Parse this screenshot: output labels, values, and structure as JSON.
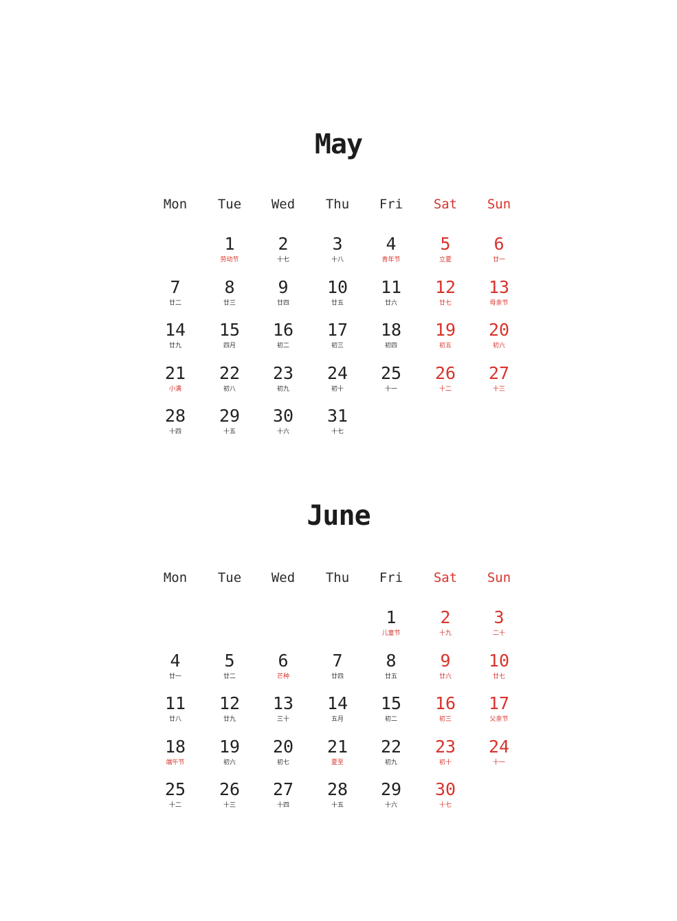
{
  "colors": {
    "text": "#222222",
    "weekend": "#d8332b",
    "background": "#ffffff"
  },
  "weekdays": [
    "Mon",
    "Tue",
    "Wed",
    "Thu",
    "Fri",
    "Sat",
    "Sun"
  ],
  "months": [
    {
      "name": "May",
      "days": [
        {
          "day": "1",
          "lunar": "劳动节",
          "festival": true
        },
        {
          "day": "2",
          "lunar": "十七"
        },
        {
          "day": "3",
          "lunar": "十八"
        },
        {
          "day": "4",
          "lunar": "青年节",
          "festival": true
        },
        {
          "day": "5",
          "lunar": "立夏",
          "festival": true
        },
        {
          "day": "6",
          "lunar": "廿一"
        },
        {
          "day": "7",
          "lunar": "廿二"
        },
        {
          "day": "8",
          "lunar": "廿三"
        },
        {
          "day": "9",
          "lunar": "廿四"
        },
        {
          "day": "10",
          "lunar": "廿五"
        },
        {
          "day": "11",
          "lunar": "廿六"
        },
        {
          "day": "12",
          "lunar": "廿七"
        },
        {
          "day": "13",
          "lunar": "母亲节",
          "festival": true
        },
        {
          "day": "14",
          "lunar": "廿九"
        },
        {
          "day": "15",
          "lunar": "四月"
        },
        {
          "day": "16",
          "lunar": "初二"
        },
        {
          "day": "17",
          "lunar": "初三"
        },
        {
          "day": "18",
          "lunar": "初四"
        },
        {
          "day": "19",
          "lunar": "初五"
        },
        {
          "day": "20",
          "lunar": "初六"
        },
        {
          "day": "21",
          "lunar": "小满",
          "festival": true
        },
        {
          "day": "22",
          "lunar": "初八"
        },
        {
          "day": "23",
          "lunar": "初九"
        },
        {
          "day": "24",
          "lunar": "初十"
        },
        {
          "day": "25",
          "lunar": "十一"
        },
        {
          "day": "26",
          "lunar": "十二"
        },
        {
          "day": "27",
          "lunar": "十三"
        },
        {
          "day": "28",
          "lunar": "十四"
        },
        {
          "day": "29",
          "lunar": "十五"
        },
        {
          "day": "30",
          "lunar": "十六"
        },
        {
          "day": "31",
          "lunar": "十七"
        }
      ]
    },
    {
      "name": "June",
      "days": [
        {
          "day": "1",
          "lunar": "儿童节",
          "festival": true
        },
        {
          "day": "2",
          "lunar": "十九"
        },
        {
          "day": "3",
          "lunar": "二十"
        },
        {
          "day": "4",
          "lunar": "廿一"
        },
        {
          "day": "5",
          "lunar": "廿二"
        },
        {
          "day": "6",
          "lunar": "芒种",
          "festival": true
        },
        {
          "day": "7",
          "lunar": "廿四"
        },
        {
          "day": "8",
          "lunar": "廿五"
        },
        {
          "day": "9",
          "lunar": "廿六"
        },
        {
          "day": "10",
          "lunar": "廿七"
        },
        {
          "day": "11",
          "lunar": "廿八"
        },
        {
          "day": "12",
          "lunar": "廿九"
        },
        {
          "day": "13",
          "lunar": "三十"
        },
        {
          "day": "14",
          "lunar": "五月"
        },
        {
          "day": "15",
          "lunar": "初二"
        },
        {
          "day": "16",
          "lunar": "初三"
        },
        {
          "day": "17",
          "lunar": "父亲节",
          "festival": true
        },
        {
          "day": "18",
          "lunar": "端午节",
          "festival": true
        },
        {
          "day": "19",
          "lunar": "初六"
        },
        {
          "day": "20",
          "lunar": "初七"
        },
        {
          "day": "21",
          "lunar": "夏至",
          "festival": true
        },
        {
          "day": "22",
          "lunar": "初九"
        },
        {
          "day": "23",
          "lunar": "初十"
        },
        {
          "day": "24",
          "lunar": "十一"
        },
        {
          "day": "25",
          "lunar": "十二"
        },
        {
          "day": "26",
          "lunar": "十三"
        },
        {
          "day": "27",
          "lunar": "十四"
        },
        {
          "day": "28",
          "lunar": "十五"
        },
        {
          "day": "29",
          "lunar": "十六"
        },
        {
          "day": "30",
          "lunar": "十七"
        }
      ]
    }
  ]
}
